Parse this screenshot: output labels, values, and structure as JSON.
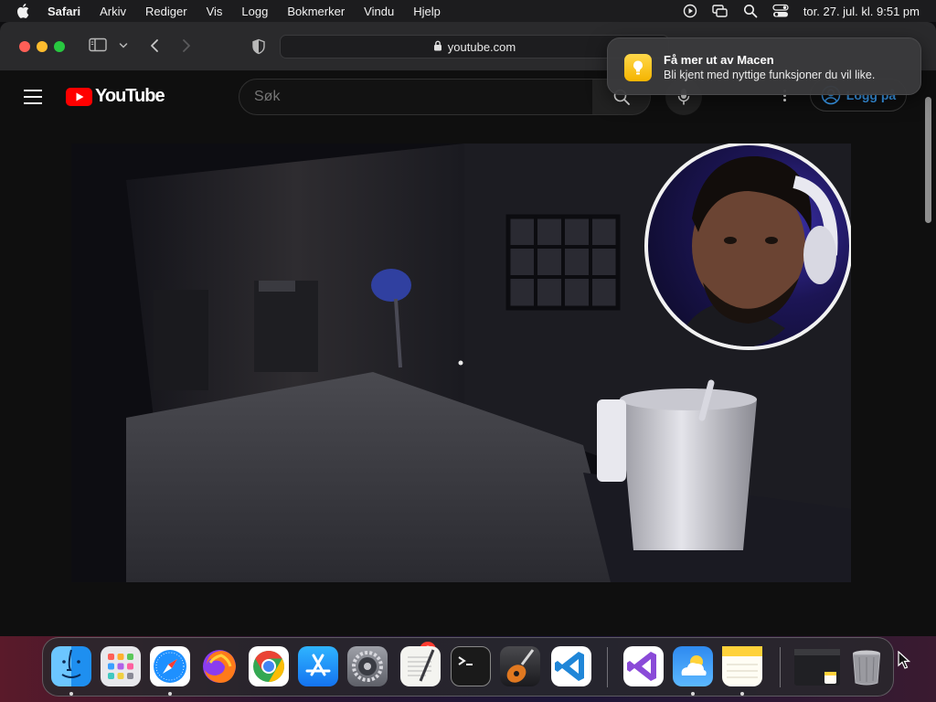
{
  "menubar": {
    "app_name": "Safari",
    "items": [
      "Arkiv",
      "Rediger",
      "Vis",
      "Logg",
      "Bokmerker",
      "Vindu",
      "Hjelp"
    ],
    "clock": "tor. 27. jul. kl. 9:51 pm",
    "status_icons": [
      "play-circle-icon",
      "screen-mirroring-icon",
      "spotlight-search-icon",
      "control-center-icon"
    ]
  },
  "safari": {
    "url": "youtube.com",
    "toolbar_icons": [
      "sidebar-icon",
      "chevron-down-icon",
      "back-arrow-icon",
      "forward-arrow-icon",
      "privacy-shield-icon",
      "lock-icon"
    ]
  },
  "youtube": {
    "logo_text": "YouTube",
    "search_placeholder": "Søk",
    "signin_label": "Logg på",
    "colors": {
      "brand_red": "#ff0000",
      "link_blue": "#3ea6ff"
    }
  },
  "notification": {
    "title": "Få mer ut av Macen",
    "body": "Bli kjent med nyttige funksjoner du vil like."
  },
  "dock": {
    "apps": [
      "Finder",
      "Launchpad",
      "Safari",
      "Firefox",
      "Google Chrome",
      "App Store",
      "Systeminnstillinger",
      "TextEdit",
      "Terminal",
      "GarageBand",
      "Visual Studio Code",
      "Visual Studio",
      "Værmelding",
      "Notater",
      "Nylige vinduer",
      "Papirkurv"
    ],
    "settings_badge": "2"
  }
}
